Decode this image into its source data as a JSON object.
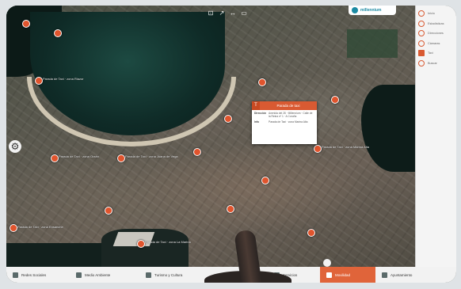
{
  "map": {
    "toolbar_icons": [
      "rotate-icon",
      "measure-icon",
      "zoom-in-icon",
      "zoom-out-icon"
    ],
    "toolbar_glyphs": [
      "⊡",
      "↗",
      "↔",
      "▭"
    ],
    "popup": {
      "icon": "T",
      "title": "Parada de taxi",
      "rows": [
        {
          "key": "Dirección",
          "value": "Avenida del 28 · Millennium · Calle de la Reina nº 1 · A Coruña"
        },
        {
          "key": "Info",
          "value": "Parada de Taxi · zona Marina Alta"
        }
      ]
    },
    "pins": [
      {
        "label": "Parada de Taxi · zona Riazor"
      },
      {
        "label": "Parada de Taxi · zona Ensanche"
      },
      {
        "label": "Parada de Taxi · zona Orzán"
      },
      {
        "label": "Parada de Taxi · zona Marina Alta"
      },
      {
        "label": "Parada de Taxi · zona La Marina"
      },
      {
        "label": "Parada de Taxi · zona Juana de Vega"
      }
    ]
  },
  "logo": {
    "text": "millennium"
  },
  "sidebar": {
    "items": [
      {
        "label": "Inicio",
        "icon": "home-icon"
      },
      {
        "label": "Estadísticas",
        "icon": "stats-icon"
      },
      {
        "label": "Direcciones",
        "icon": "directions-icon"
      },
      {
        "label": "Cámaras",
        "icon": "camera-icon"
      },
      {
        "label": "Taxi",
        "icon": "taxi-icon"
      },
      {
        "label": "Buscar",
        "icon": "search-icon"
      }
    ]
  },
  "bottom_nav": {
    "items": [
      {
        "label": "Redes Sociales",
        "icon": "social-icon",
        "active": false
      },
      {
        "label": "Medio Ambiente",
        "icon": "environment-icon",
        "active": false
      },
      {
        "label": "Turismo y Cultura",
        "icon": "tourism-icon",
        "active": false
      },
      {
        "label": "Servicios",
        "icon": "services-icon",
        "active": false
      },
      {
        "label": "Movilidad",
        "icon": "mobility-icon",
        "active": true
      },
      {
        "label": "Ayuntamiento",
        "icon": "townhall-icon",
        "active": false
      }
    ]
  },
  "colors": {
    "accent": "#e0643a",
    "sidebar_bg": "#f4f4f4",
    "sea": "#0f2b27"
  }
}
